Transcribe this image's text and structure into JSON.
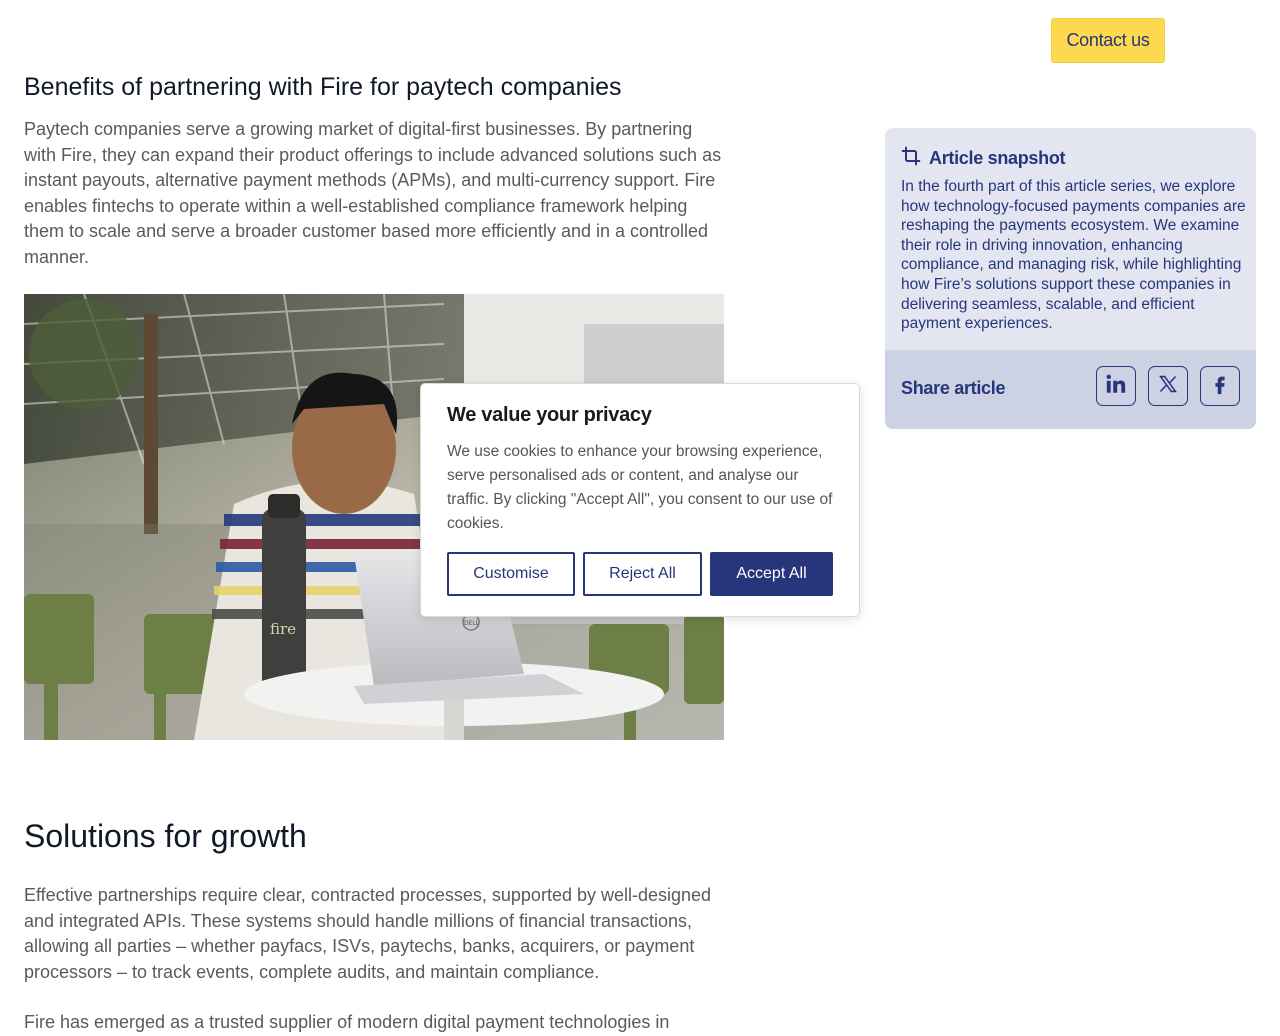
{
  "header": {
    "contact_label": "Contact us"
  },
  "section1": {
    "heading": "Benefits of partnering with Fire for paytech companies",
    "paragraph": "Paytech companies serve a growing market of digital-first businesses. By partnering with Fire, they can expand their product offerings to include advanced solutions such as instant payouts, alternative payment methods (APMs), and multi-currency support. Fire enables fintechs to operate within a well-established compliance framework helping them to scale and serve a broader customer based more efficiently and in a controlled manner."
  },
  "photo": {
    "bottle_logo": "fire",
    "laptop_logo": "DELL"
  },
  "section2": {
    "heading": "Solutions for growth",
    "paragraph1": "Effective partnerships require clear, contracted processes, supported by well-designed and integrated APIs. These systems should handle millions of financial transactions, allowing all parties – whether payfacs, ISVs, paytechs, banks, acquirers, or payment processors – to track events, complete audits, and maintain compliance.",
    "paragraph2": "Fire has emerged as a trusted supplier of modern digital payment technologies in"
  },
  "snapshot": {
    "icon": "crop-icon",
    "title": "Article snapshot",
    "body": "In the fourth part of this article series, we explore how technology-focused payments companies are reshaping the payments ecosystem. We examine their role in driving innovation, enhancing compliance, and managing risk, while highlighting how Fire’s solutions support these companies in delivering seamless, scalable, and efficient payment experiences.",
    "share_label": "Share article",
    "share_icons": [
      "linkedin-icon",
      "x-icon",
      "facebook-icon"
    ]
  },
  "cookie": {
    "title": "We value your privacy",
    "text": "We use cookies to enhance your browsing experience, serve personalised ads or content, and analyse our traffic. By clicking \"Accept All\", you consent to our use of cookies.",
    "customise": "Customise",
    "reject": "Reject All",
    "accept": "Accept All"
  },
  "colors": {
    "brand_navy": "#27367a",
    "brand_yellow": "#fdd94f",
    "snapshot_bg": "#e3e6f1",
    "share_bg": "#ccd1e3"
  }
}
